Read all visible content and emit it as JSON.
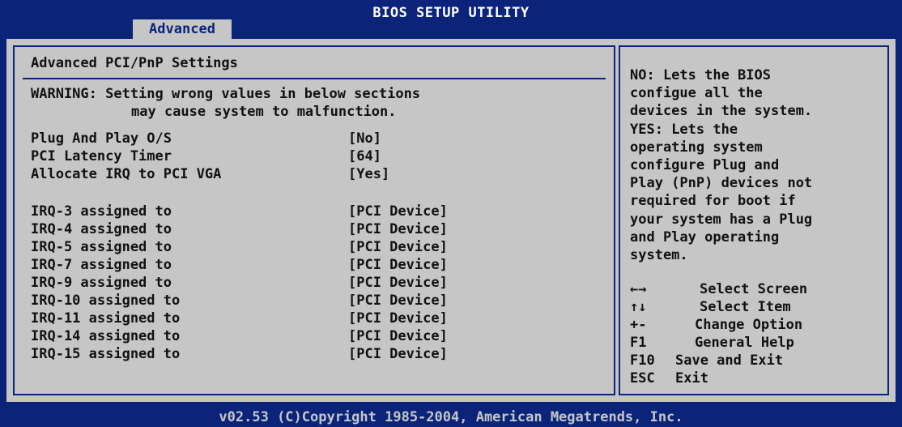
{
  "header": {
    "title": "BIOS SETUP UTILITY",
    "active_tab": "Advanced"
  },
  "section": {
    "title": "Advanced PCI/PnP Settings",
    "warning_line1": "WARNING: Setting wrong values in below sections",
    "warning_line2": "may cause system to malfunction."
  },
  "settings": [
    {
      "label": "Plug And Play O/S",
      "value": "[No]"
    },
    {
      "label": "PCI Latency Timer",
      "value": "[64]"
    },
    {
      "label": "Allocate IRQ to PCI VGA",
      "value": "[Yes]"
    },
    {
      "label": "IRQ-3 assigned to",
      "value": "[PCI Device]"
    },
    {
      "label": "IRQ-4 assigned to",
      "value": "[PCI Device]"
    },
    {
      "label": "IRQ-5 assigned to",
      "value": "[PCI Device]"
    },
    {
      "label": "IRQ-7 assigned to",
      "value": "[PCI Device]"
    },
    {
      "label": "IRQ-9 assigned to",
      "value": "[PCI Device]"
    },
    {
      "label": "IRQ-10 assigned to",
      "value": "[PCI Device]"
    },
    {
      "label": "IRQ-11 assigned to",
      "value": "[PCI Device]"
    },
    {
      "label": "IRQ-14 assigned to",
      "value": "[PCI Device]"
    },
    {
      "label": "IRQ-15 assigned to",
      "value": "[PCI Device]"
    }
  ],
  "help": {
    "text": "NO: Lets the BIOS\nconfigue all the\ndevices in the system.\nYES: Lets the\noperating system\nconfigure Plug and\nPlay (PnP) devices not\nrequired for boot if\nyour system has a Plug\nand Play operating\nsystem."
  },
  "keys": [
    {
      "key": "←→",
      "desc": "Select Screen",
      "icon": "left-right-arrows-icon"
    },
    {
      "key": "↑↓",
      "desc": "Select Item",
      "icon": "up-down-arrows-icon"
    },
    {
      "key": "+-",
      "desc": "Change Option",
      "icon": "plus-minus-icon"
    },
    {
      "key": "F1",
      "desc": "General Help",
      "icon": ""
    },
    {
      "key": "F10",
      "desc": "Save and Exit",
      "icon": ""
    },
    {
      "key": "ESC",
      "desc": "Exit",
      "icon": ""
    }
  ],
  "footer": {
    "text": "v02.53 (C)Copyright 1985-2004, American Megatrends, Inc."
  },
  "colors": {
    "background": "#0b2479",
    "panel": "#c6c6c6",
    "text": "#111111",
    "title_text": "#ffffff"
  }
}
